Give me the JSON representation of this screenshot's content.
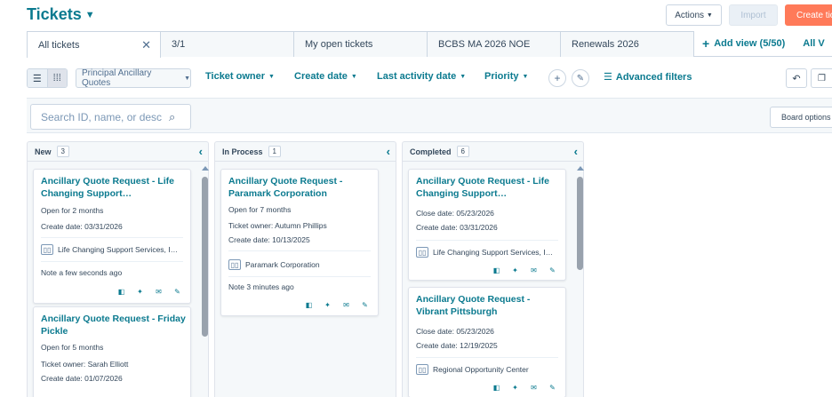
{
  "header": {
    "title": "Tickets",
    "actions_label": "Actions",
    "import_label": "Import",
    "create_label": "Create tic"
  },
  "tabs": {
    "items": [
      {
        "label": "All tickets"
      },
      {
        "label": "3/1"
      },
      {
        "label": "My open tickets"
      },
      {
        "label": "BCBS MA 2026 NOE"
      },
      {
        "label": "Renewals 2026"
      }
    ],
    "add_view": "Add view (5/50)",
    "all_views": "All V"
  },
  "filters": {
    "pipeline": "Principal Ancillary Quotes",
    "ticket_owner": "Ticket owner",
    "create_date": "Create date",
    "last_activity_date": "Last activity date",
    "priority": "Priority",
    "advanced_filters": "Advanced filters"
  },
  "search": {
    "placeholder": "Search ID, name, or desc"
  },
  "board_options": "Board options",
  "columns": [
    {
      "name": "New",
      "count": "3",
      "cards": [
        {
          "title": "Ancillary Quote Request - Life Changing Support…",
          "line1": "Open for 2 months",
          "line2": "Create date: 03/31/2026",
          "assoc": "Life Changing Support Services, I…",
          "note": "Note a few seconds ago"
        },
        {
          "title": "Ancillary Quote Request - Friday Pickle",
          "line1": "Open for 5 months",
          "line2": "Ticket owner: Sarah Elliott",
          "line3": "Create date: 01/07/2026"
        }
      ]
    },
    {
      "name": "In Process",
      "count": "1",
      "cards": [
        {
          "title": "Ancillary Quote Request - Paramark Corporation",
          "line1": "Open for 7 months",
          "line2": "Ticket owner: Autumn Phillips",
          "line3": "Create date: 10/13/2025",
          "assoc": "Paramark Corporation",
          "note": "Note 3 minutes ago"
        }
      ]
    },
    {
      "name": "Completed",
      "count": "6",
      "cards": [
        {
          "title": "Ancillary Quote Request - Life Changing Support…",
          "line1": "Close date: 05/23/2026",
          "line2": "Create date: 03/31/2026",
          "assoc": "Life Changing Support Services, I…"
        },
        {
          "title": "Ancillary Quote Request - Vibrant Pittsburgh",
          "line1": "Close date: 05/23/2026",
          "line2": "Create date: 12/19/2025",
          "assoc": "Regional Opportunity Center"
        }
      ]
    }
  ],
  "colors": {
    "accent": "#0b7a8f",
    "primary_button": "#ff7a59",
    "board_background": "#f5f8fa"
  },
  "icons": [
    "caret-down-icon",
    "close-icon",
    "plus-icon",
    "list-view-icon",
    "board-view-icon",
    "edit-icon",
    "filter-icon",
    "search-icon",
    "undo-icon",
    "copy-icon",
    "chevron-left-icon",
    "building-icon",
    "preview-icon",
    "sparkle-icon",
    "email-icon",
    "edit-icon"
  ]
}
